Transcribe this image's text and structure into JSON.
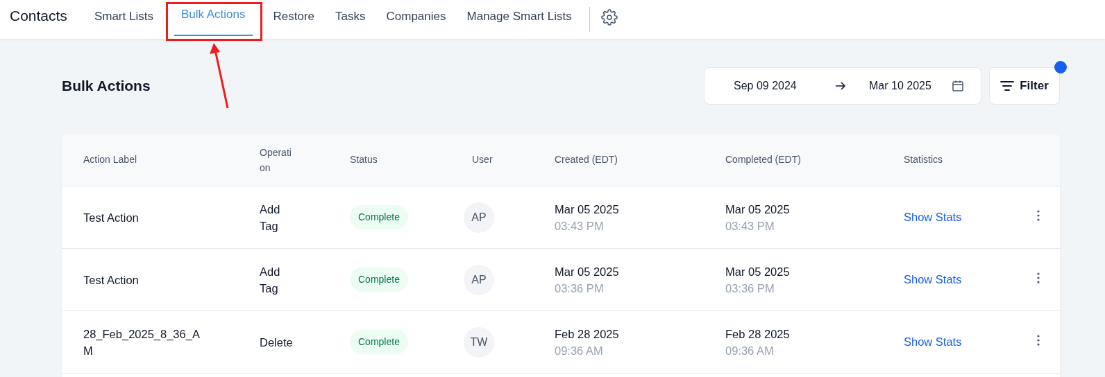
{
  "app_title": "Contacts",
  "tabs": [
    {
      "label": "Smart Lists",
      "selected": false
    },
    {
      "label": "Bulk Actions",
      "selected": true
    },
    {
      "label": "Restore",
      "selected": false
    },
    {
      "label": "Tasks",
      "selected": false
    },
    {
      "label": "Companies",
      "selected": false
    },
    {
      "label": "Manage Smart Lists",
      "selected": false
    }
  ],
  "page_title": "Bulk Actions",
  "date_range": {
    "start": "Sep 09 2024",
    "end": "Mar 10 2025"
  },
  "filter": {
    "label": "Filter",
    "indicator": true
  },
  "table": {
    "columns": [
      "Action Label",
      "Operation",
      "Status",
      "User",
      "Created (EDT)",
      "Completed (EDT)",
      "Statistics"
    ],
    "rows": [
      {
        "action_label": "Test Action",
        "operation": "Add Tag",
        "status": "Complete",
        "user": "AP",
        "created_date": "Mar 05 2025",
        "created_time": "03:43 PM",
        "completed_date": "Mar 05 2025",
        "completed_time": "03:43 PM",
        "statistics": "Show Stats"
      },
      {
        "action_label": "Test Action",
        "operation": "Add Tag",
        "status": "Complete",
        "user": "AP",
        "created_date": "Mar 05 2025",
        "created_time": "03:36 PM",
        "completed_date": "Mar 05 2025",
        "completed_time": "03:36 PM",
        "statistics": "Show Stats"
      },
      {
        "action_label": "28_Feb_2025_8_36_AM",
        "operation": "Delete",
        "status": "Complete",
        "user": "TW",
        "created_date": "Feb 28 2025",
        "created_time": "09:36 AM",
        "completed_date": "Feb 28 2025",
        "completed_time": "09:36 AM",
        "statistics": "Show Stats"
      }
    ]
  }
}
